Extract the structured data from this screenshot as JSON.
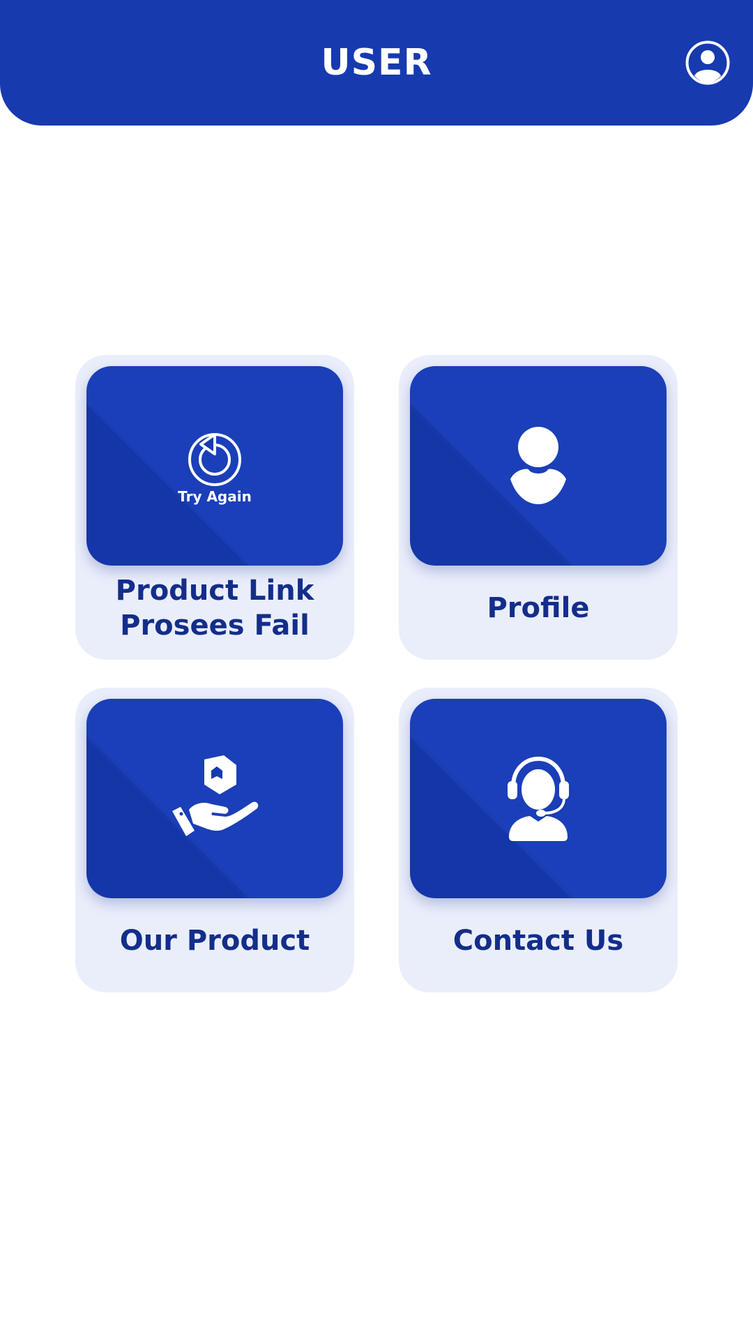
{
  "header": {
    "title": "USER",
    "account_icon": "account-circle-icon"
  },
  "cards": [
    {
      "label": "Product Link\nProsees Fail",
      "icon": "retry-icon",
      "icon_caption": "Try Again"
    },
    {
      "label": "Profile",
      "icon": "person-icon"
    },
    {
      "label": "Our Product",
      "icon": "hand-box-icon"
    },
    {
      "label": "Contact Us",
      "icon": "headset-support-icon"
    }
  ],
  "colors": {
    "primary": "#173aaf",
    "card_background": "#eaeefb",
    "label_text": "#132e8a"
  }
}
